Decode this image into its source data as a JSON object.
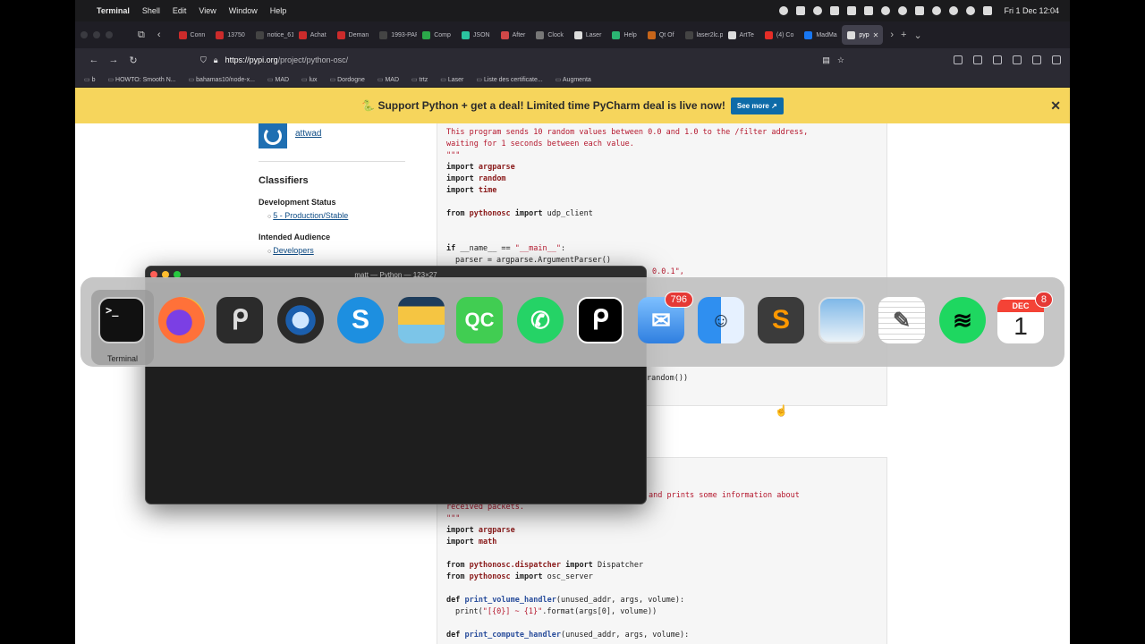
{
  "menubar": {
    "app": "Terminal",
    "items": [
      "Shell",
      "Edit",
      "View",
      "Window",
      "Help"
    ],
    "clock": "Fri 1 Dec  12:04"
  },
  "browser": {
    "tabs": [
      {
        "label": "Conn",
        "color": "#cc2b2b"
      },
      {
        "label": "13750",
        "color": "#cc2b2b"
      },
      {
        "label": "notice_61",
        "color": "#444"
      },
      {
        "label": "Achat",
        "color": "#cc2b2b"
      },
      {
        "label": "Deman",
        "color": "#cc2b2b"
      },
      {
        "label": "1993-PAR",
        "color": "#444"
      },
      {
        "label": "Comp",
        "color": "#2ba84a"
      },
      {
        "label": "JSON",
        "color": "#2bc4a0"
      },
      {
        "label": "After",
        "color": "#d04848"
      },
      {
        "label": "Clock",
        "color": "#777"
      },
      {
        "label": "Laser",
        "color": "#ddd"
      },
      {
        "label": "Help",
        "color": "#2bb573"
      },
      {
        "label": "Qt Of",
        "color": "#c7651a"
      },
      {
        "label": "laser2lc.p",
        "color": "#444"
      },
      {
        "label": "ArtTe",
        "color": "#ddd"
      },
      {
        "label": "(4) Co",
        "color": "#e52d27"
      },
      {
        "label": "MadMa",
        "color": "#1877f2"
      }
    ],
    "active_tab": "pyp",
    "url_host": "https://pypi.org",
    "url_path": "/project/python-osc/",
    "bookmarks": [
      "b",
      "HOWTO: Smooth N...",
      "bahamas10/node-x...",
      "MAD",
      "lux",
      "Dordogne",
      "MAD",
      "trtz",
      "Laser",
      "Liste des certificate...",
      "Augmenta"
    ]
  },
  "banner": {
    "text": "🐍 Support Python + get a deal! Limited time PyCharm deal is live now!",
    "button": "See more ↗",
    "close": "✕"
  },
  "sidebar": {
    "maintainer": "attwad",
    "classifiers_heading": "Classifiers",
    "dev_status_heading": "Development Status",
    "dev_status_value": "5 - Production/Stable",
    "audience_heading": "Intended Audience",
    "audience_value": "Developers"
  },
  "code1": {
    "doc1": "This program sends 10 random values between 0.0 and 1.0 to the /filter address,",
    "doc2": "waiting for 1 seconds between each value.",
    "doc3": "\"\"\"",
    "imp1_mod": "argparse",
    "imp2_mod": "random",
    "imp3_mod": "time",
    "from_mod": "pythonosc",
    "from_name": "udp_client",
    "main_test": "__name__ == ",
    "main_str": "\"__main__\"",
    "main_colon": ":",
    "parser_line": "parser = argparse.ArgumentParser()",
    "ip_frag": "0.0.1\",",
    "random_frag": "random())"
  },
  "code2": {
    "doc1": "and prints some information about",
    "doc2": "received packets.",
    "doc3": "\"\"\"",
    "imp1_mod": "argparse",
    "imp2_mod": "math",
    "from1_mod": "pythonosc.dispatcher",
    "from1_name": "Dispatcher",
    "from2_mod": "pythonosc",
    "from2_name": "osc_server",
    "def1": "print_volume_handler",
    "def1_args": "(unused_addr, args, volume):",
    "print1_call": "print(",
    "print1_str": "\"[{0}] ~ {1}\"",
    "print1_rest": ".format(args[0], volume))",
    "def2": "print_compute_handler",
    "def2_args": "(unused_addr, args, volume):"
  },
  "keywords": {
    "import": "import",
    "from": "from",
    "if": "if",
    "def": "def"
  },
  "terminal": {
    "title": "matt — Python — 123×27"
  },
  "dock": {
    "selected_label": "Terminal",
    "mail_badge": "796",
    "calendar_month": "DEC",
    "calendar_day": "1",
    "calendar_badge": "8",
    "terminal_prompt": ">_",
    "qt_label": "QC"
  }
}
